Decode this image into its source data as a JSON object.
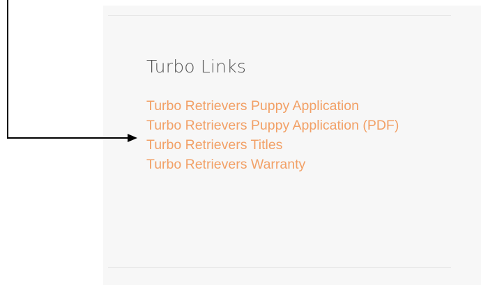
{
  "sidebar": {
    "widget_title": "Turbo Links",
    "links": [
      {
        "label": "Turbo Retrievers Puppy Application"
      },
      {
        "label": "Turbo Retrievers Puppy Application (PDF)"
      },
      {
        "label": "Turbo Retrievers Titles"
      },
      {
        "label": "Turbo Retrievers Warranty"
      }
    ]
  },
  "colors": {
    "link": "#f2a066",
    "title": "#555555",
    "panel_background": "#f7f7f7",
    "annotation": "#000000"
  },
  "annotation": {
    "icon": "arrow-right-icon",
    "points_to": "Turbo Retrievers Puppy Application (PDF)"
  }
}
